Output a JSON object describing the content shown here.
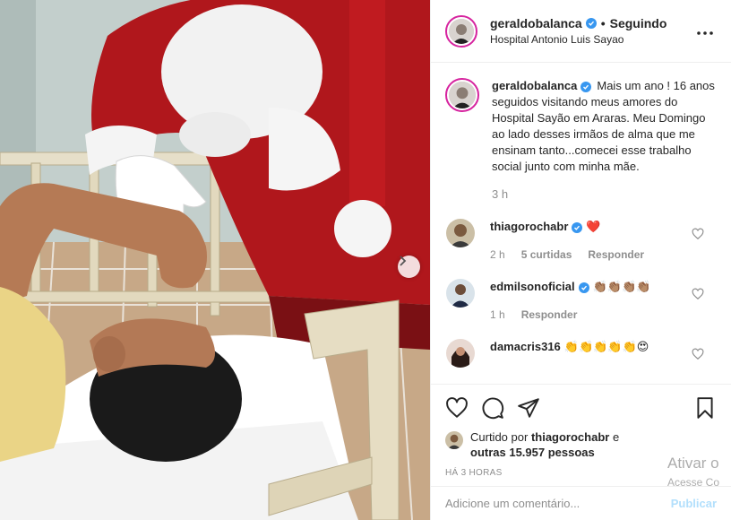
{
  "post": {
    "username": "geraldobalanca",
    "follow_status": "Seguindo",
    "location": "Hospital Antonio Luis Sayao",
    "more_icon": "more-horizontal-icon"
  },
  "caption": {
    "username": "geraldobalanca",
    "text": "Mais um ano ! 16 anos seguidos visitando meus amores do Hospital Sayão em Araras. Meu Domingo ao lado desses irmãos de alma que me ensinam tanto...comecei esse trabalho social junto com minha mãe.",
    "time": "3 h"
  },
  "comments": [
    {
      "username": "thiagorochabr",
      "text": "❤️",
      "time": "2 h",
      "likes": "5 curtidas",
      "reply": "Responder"
    },
    {
      "username": "edmilsonoficial",
      "text": "👏🏽👏🏽👏🏽👏🏽",
      "time": "1 h",
      "reply": "Responder"
    },
    {
      "username": "damacris316",
      "text": "👏👏👏👏👏😍"
    }
  ],
  "likes": {
    "prefix": "Curtido por",
    "user": "thiagorochabr",
    "and": "e",
    "others": "outras 15.957 pessoas"
  },
  "posted_ago": "HÁ 3 HORAS",
  "add_comment": {
    "placeholder": "Adicione um comentário...",
    "publish": "Publicar"
  },
  "watermark": {
    "line1": "Ativar o",
    "line2": "Acesse Co"
  },
  "colors": {
    "verified": "#3897f0",
    "publish_disabled": "#b2dffc",
    "santa_red": "#b0171c"
  }
}
